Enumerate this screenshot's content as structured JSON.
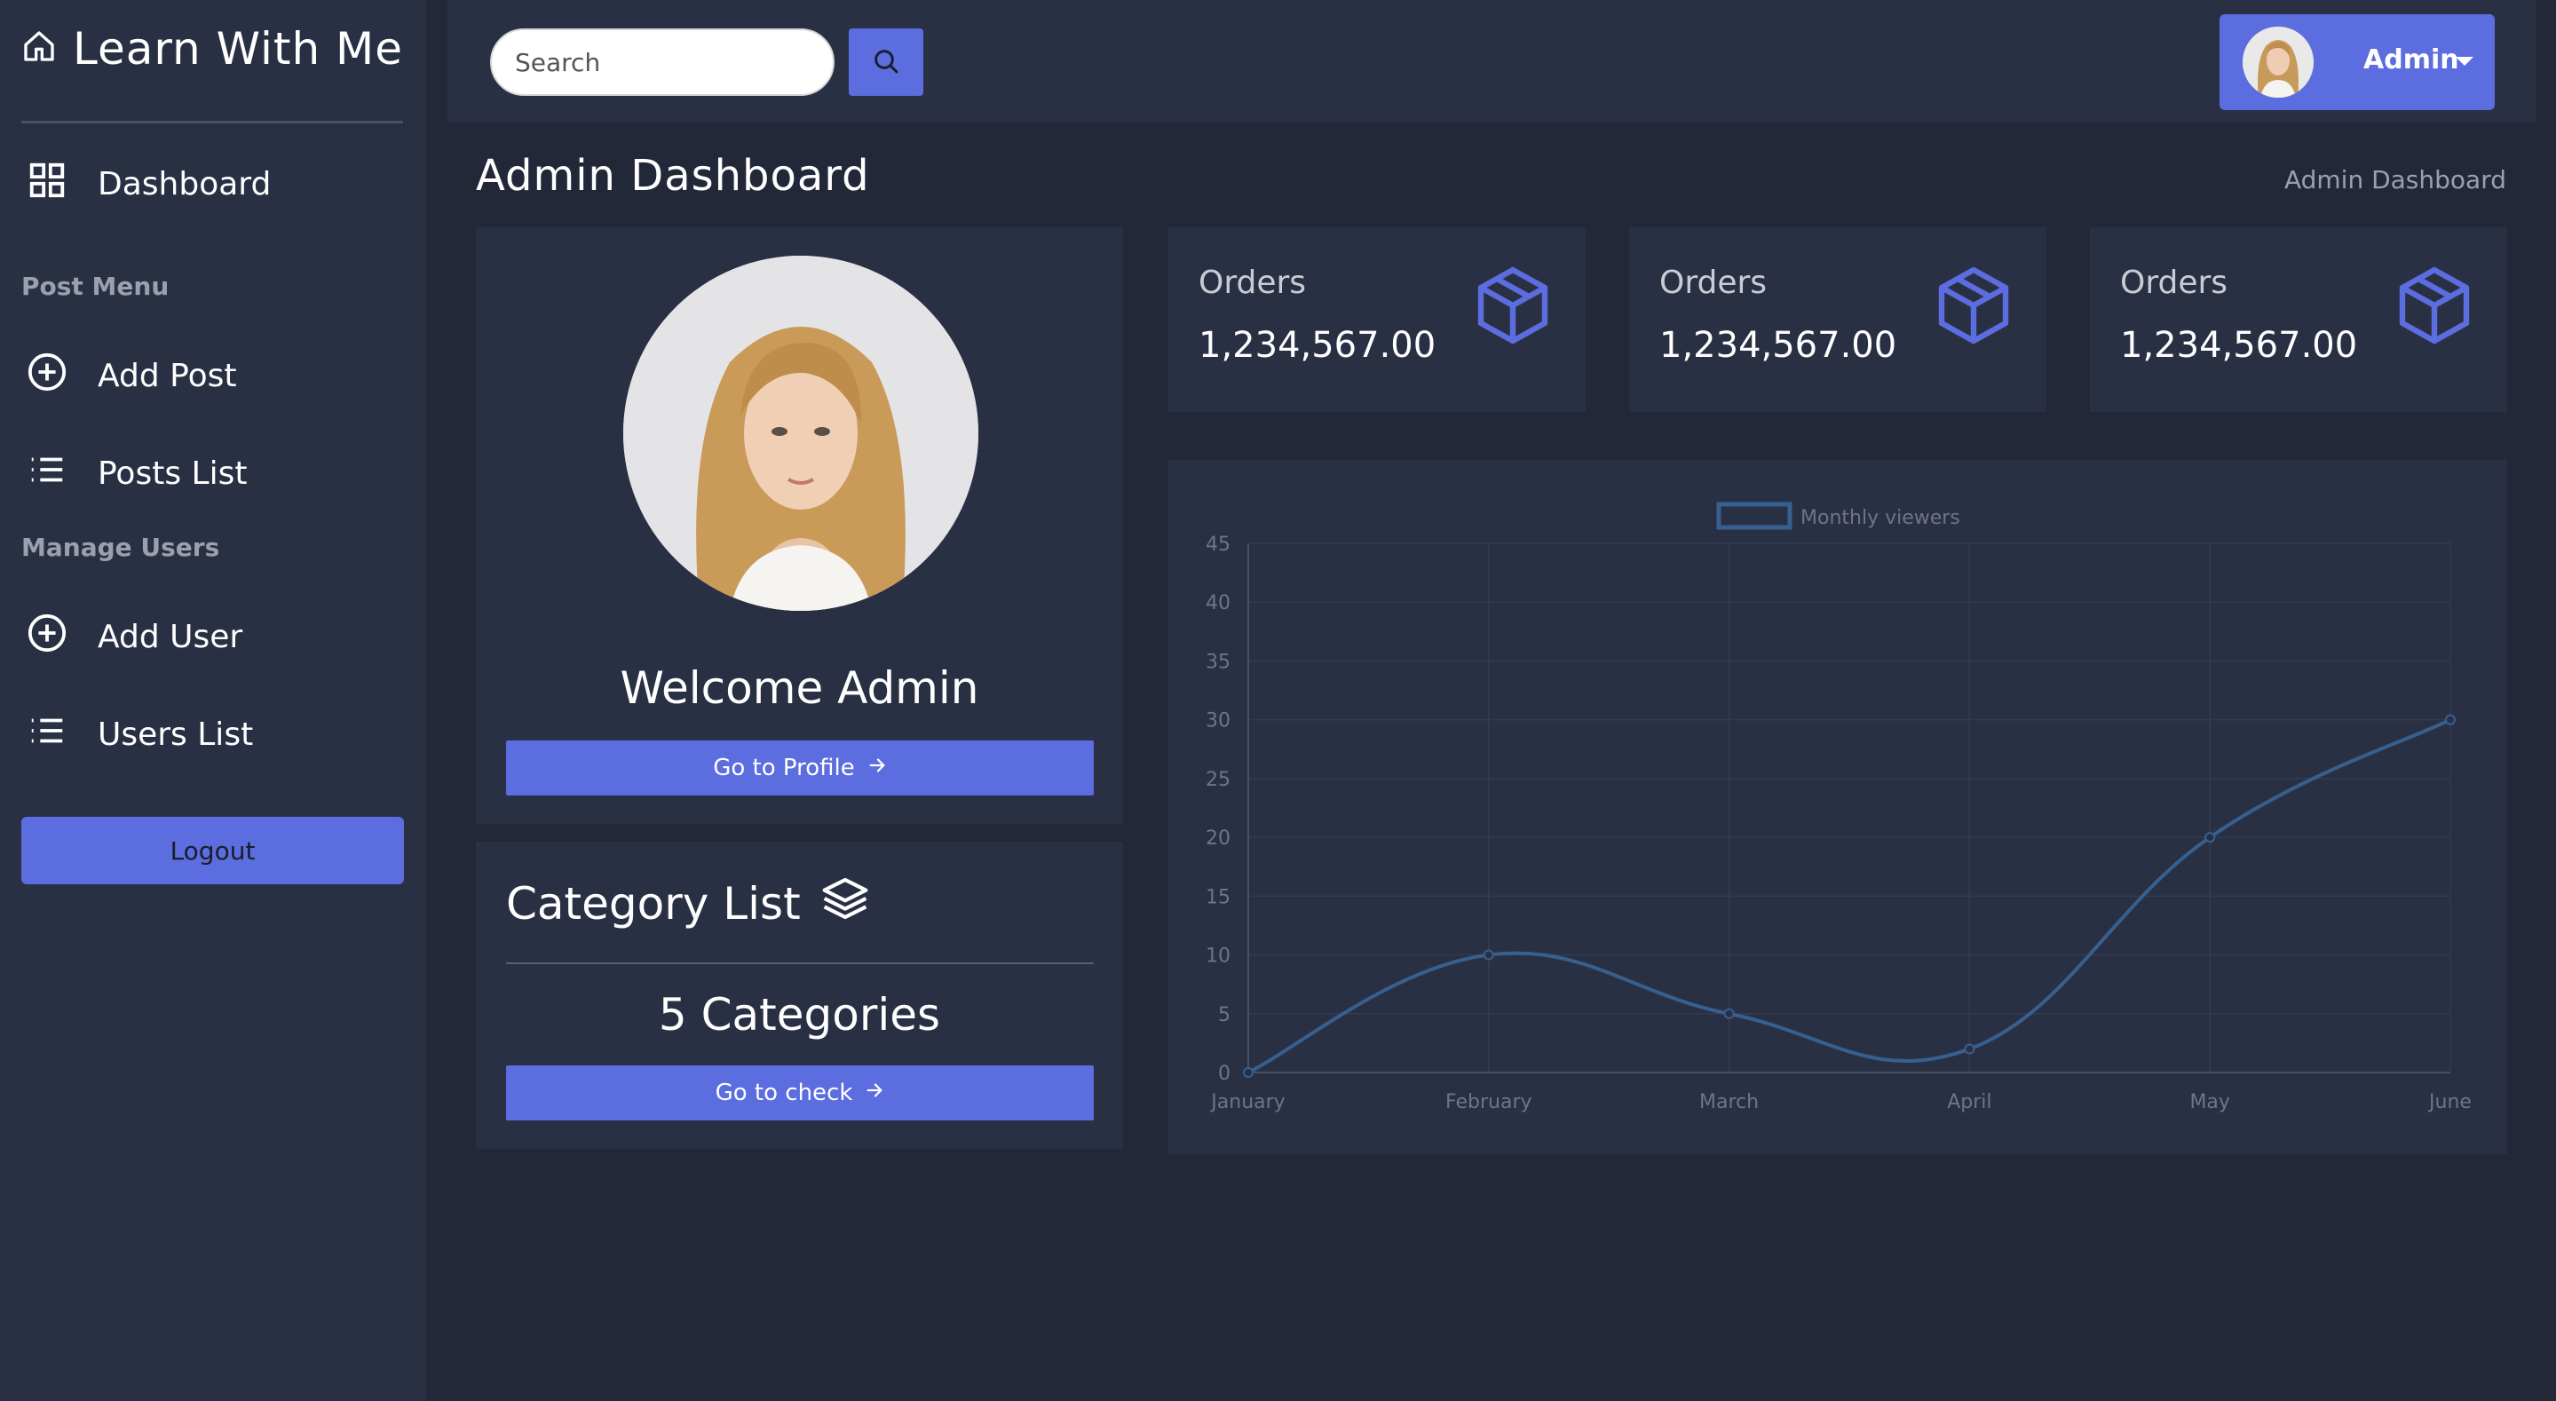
{
  "sidebar": {
    "brand": "Learn With Me",
    "dashboard": "Dashboard",
    "post_section": "Post Menu",
    "add_post": "Add Post",
    "posts_list": "Posts List",
    "users_section": "Manage Users",
    "add_user": "Add User",
    "users_list": "Users List",
    "logout": "Logout"
  },
  "topbar": {
    "search_placeholder": "Search",
    "user_name": "Admin"
  },
  "header": {
    "title": "Admin Dashboard",
    "breadcrumb": "Admin Dashboard"
  },
  "profile": {
    "welcome": "Welcome Admin",
    "button": "Go to Profile"
  },
  "category": {
    "title": "Category List",
    "count": "5 Categories",
    "button": "Go to check"
  },
  "stats": [
    {
      "label": "Orders",
      "value": "1,234,567.00"
    },
    {
      "label": "Orders",
      "value": "1,234,567.00"
    },
    {
      "label": "Orders",
      "value": "1,234,567.00"
    }
  ],
  "colors": {
    "accent": "#5b6ddf",
    "panel": "#2a3044",
    "background": "#232839",
    "line": "#36608f"
  },
  "chart_data": {
    "type": "line",
    "categories": [
      "January",
      "February",
      "March",
      "April",
      "May",
      "June"
    ],
    "series": [
      {
        "name": "Monthly viewers",
        "values": [
          0,
          10,
          5,
          2,
          20,
          30
        ]
      }
    ],
    "ylim": [
      0,
      45
    ],
    "yticks": [
      0,
      5,
      10,
      15,
      20,
      25,
      30,
      35,
      40,
      45
    ],
    "legend_position": "top-center",
    "grid": true
  }
}
